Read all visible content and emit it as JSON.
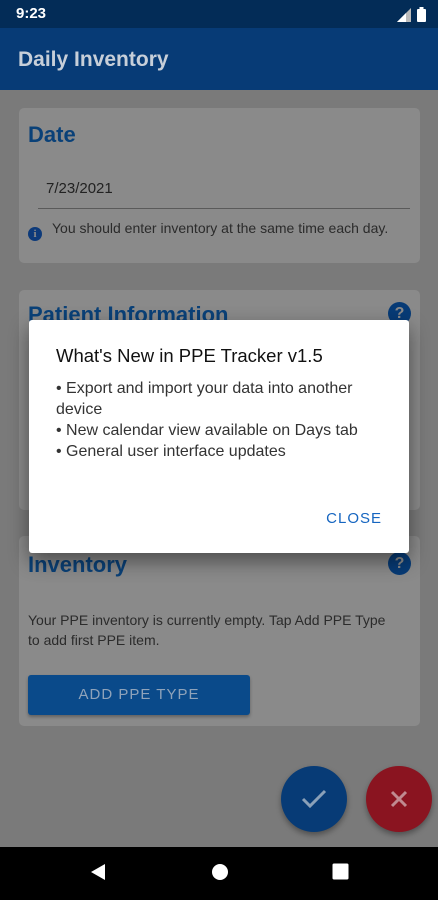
{
  "status": {
    "time": "9:23"
  },
  "app": {
    "title": "Daily Inventory"
  },
  "date_card": {
    "title": "Date",
    "value": "7/23/2021",
    "hint": "You should enter inventory at the same time each day."
  },
  "patient_card": {
    "title": "Patient Information"
  },
  "inventory_card": {
    "title": "Inventory",
    "message": "Your PPE inventory is currently empty. Tap Add PPE Type to add first PPE item.",
    "add_button": "ADD PPE TYPE"
  },
  "dialog": {
    "title": "What's New in PPE Tracker v1.5",
    "items": [
      "• Export and import your data into another device",
      "• New calendar view available on Days tab",
      "• General user interface updates"
    ],
    "close": "CLOSE"
  },
  "colors": {
    "app_bar": "#073b76",
    "accent": "#1565c0",
    "cancel": "#8a1420"
  }
}
